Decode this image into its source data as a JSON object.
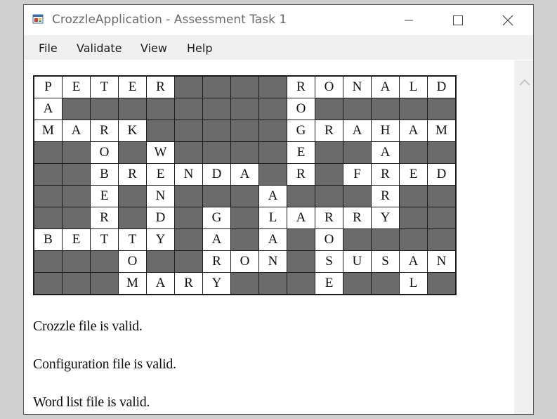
{
  "window": {
    "title": "CrozzleApplication - Assessment Task 1",
    "accent": "#6b6b6b"
  },
  "menu": {
    "file": "File",
    "validate": "Validate",
    "view": "View",
    "help": "Help"
  },
  "crozzle": {
    "rows": [
      [
        "P",
        "E",
        "T",
        "E",
        "R",
        "",
        "",
        "",
        "",
        "R",
        "O",
        "N",
        "A",
        "L",
        "D"
      ],
      [
        "A",
        "",
        "",
        "",
        "",
        "",
        "",
        "",
        "",
        "O",
        "",
        "",
        "",
        "",
        ""
      ],
      [
        "M",
        "A",
        "R",
        "K",
        "",
        "",
        "",
        "",
        "",
        "G",
        "R",
        "A",
        "H",
        "A",
        "M"
      ],
      [
        "",
        "",
        "O",
        "",
        "W",
        "",
        "",
        "",
        "",
        "E",
        "",
        "",
        "A",
        "",
        ""
      ],
      [
        "",
        "",
        "B",
        "R",
        "E",
        "N",
        "D",
        "A",
        "",
        "R",
        "",
        "F",
        "R",
        "E",
        "D"
      ],
      [
        "",
        "",
        "E",
        "",
        "N",
        "",
        "",
        "",
        "A",
        "",
        "",
        "",
        "R",
        "",
        ""
      ],
      [
        "",
        "",
        "R",
        "",
        "D",
        "",
        "G",
        "",
        "L",
        "A",
        "R",
        "R",
        "Y",
        "",
        ""
      ],
      [
        "B",
        "E",
        "T",
        "T",
        "Y",
        "",
        "A",
        "",
        "A",
        "",
        "O",
        "",
        "",
        "",
        ""
      ],
      [
        "",
        "",
        "",
        "O",
        "",
        "",
        "R",
        "O",
        "N",
        "",
        "S",
        "U",
        "S",
        "A",
        "N"
      ],
      [
        "",
        "",
        "",
        "M",
        "A",
        "R",
        "Y",
        "",
        "",
        "",
        "E",
        "",
        "",
        "L",
        ""
      ]
    ],
    "blank_color": "#6b6b6b"
  },
  "messages": {
    "crozzle": "Crozzle file is valid.",
    "configuration": "Configuration file is valid.",
    "wordlist": "Word list file is valid."
  }
}
